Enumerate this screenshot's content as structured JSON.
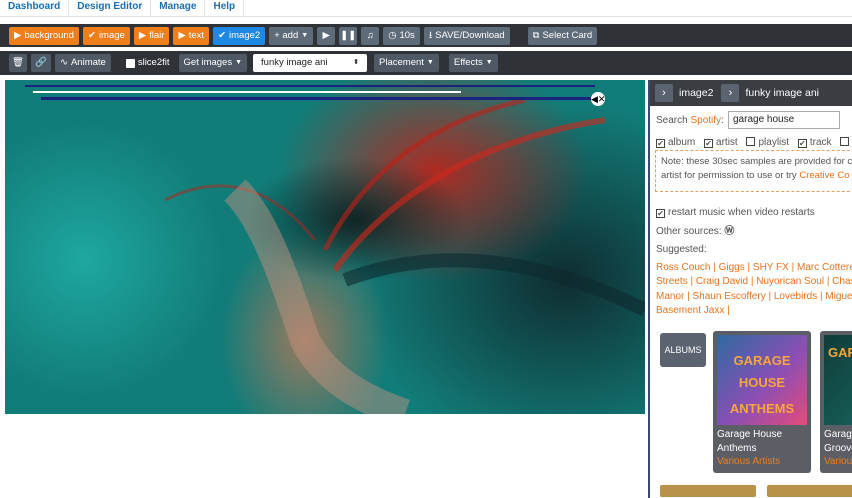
{
  "nav": {
    "tabs": [
      "Dashboard",
      "Design Editor",
      "Manage",
      "Help"
    ]
  },
  "toolbar1": {
    "background": "background",
    "image": "image",
    "flair": "flair",
    "text": "text",
    "image2": "image2",
    "add": "+ add",
    "timer": "10s",
    "save": "SAVE/Download",
    "select_card": "Select Card"
  },
  "toolbar2": {
    "animate": "Animate",
    "slice2fit": "slice2fit",
    "get_images": "Get images",
    "layer_select": "funky image ani",
    "placement": "Placement",
    "effects": "Effects"
  },
  "panel": {
    "breadcrumb": {
      "item1": "image2",
      "item2": "funky image ani"
    },
    "search_label": "Search",
    "search_source": "Spotify",
    "search_suffix": ":",
    "search_value": "garage house",
    "filters": {
      "album": "album",
      "artist": "artist",
      "playlist": "playlist",
      "track": "track"
    },
    "note_line1": "Note: these 30sec samples are provided for c",
    "note_line2_prefix": "artist for permission to use or try ",
    "note_link": "Creative Co",
    "restart": "restart music when video restarts",
    "other_sources": "Other sources:",
    "suggested": "Suggested:",
    "suggest_lines": [
      "Ross Couch | Giggs | SHY FX | Marc Cotterell |",
      "Streets | Craig David | Nuyorican Soul | Chase",
      "Manor | Shaun Escoffery | Lovebirds | Miguel |",
      "Basement Jaxx |"
    ],
    "albums_label": "ALBUMS",
    "card1": {
      "cover_line1": "GARAGE",
      "cover_line2": "HOUSE",
      "cover_line3": "ANTHEMS",
      "title1": "Garage House",
      "title2": "Anthems",
      "artist": "Various Artists"
    },
    "card2": {
      "cover_line1": "GAR",
      "title1": "Garage",
      "title2": "Groove",
      "artist": "Variou"
    }
  },
  "colors": {
    "accent": "#f07f1a",
    "primary": "#1e88e5",
    "toolbar": "#2f3237"
  }
}
